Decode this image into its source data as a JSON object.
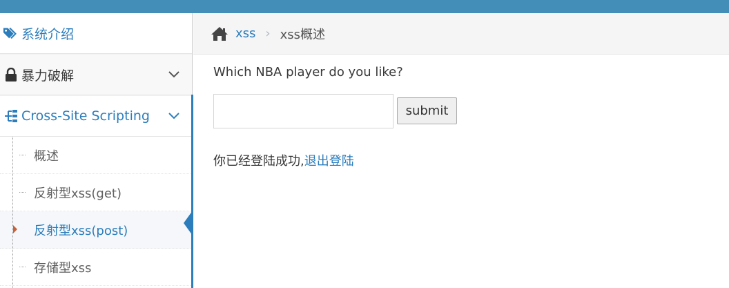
{
  "sidebar": {
    "items": [
      {
        "label": "系统介绍",
        "icon": "tags-icon"
      },
      {
        "label": "暴力破解",
        "icon": "lock-icon"
      },
      {
        "label": "Cross-Site Scripting",
        "icon": "sitemap-icon"
      }
    ],
    "submenu": [
      {
        "label": "概述"
      },
      {
        "label": "反射型xss(get)"
      },
      {
        "label": "反射型xss(post)"
      },
      {
        "label": "存储型xss"
      }
    ]
  },
  "breadcrumb": {
    "home_icon": "home-icon",
    "link": "xss",
    "separator": "›",
    "current": "xss概述"
  },
  "main": {
    "question": "Which NBA player do you like?",
    "input_value": "",
    "submit_label": "submit",
    "login_status": "你已经登陆成功,",
    "logout_link": "退出登陆"
  },
  "colors": {
    "topbar": "#438eb9",
    "accent": "#2b7dbc",
    "caret": "#c86139"
  }
}
